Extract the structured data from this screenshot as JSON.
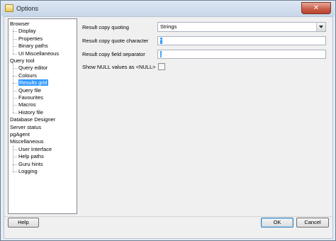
{
  "window": {
    "title": "Options",
    "close_glyph": "✕"
  },
  "tree": {
    "items": [
      {
        "label": "Browser",
        "level": 0
      },
      {
        "label": "Display",
        "level": 1
      },
      {
        "label": "Properties",
        "level": 1
      },
      {
        "label": "Binary paths",
        "level": 1
      },
      {
        "label": "UI Miscellaneous",
        "level": 1
      },
      {
        "label": "Query tool",
        "level": 0
      },
      {
        "label": "Query editor",
        "level": 1
      },
      {
        "label": "Colours",
        "level": 1
      },
      {
        "label": "Results grid",
        "level": 1,
        "selected": true
      },
      {
        "label": "Query file",
        "level": 1
      },
      {
        "label": "Favourites",
        "level": 1
      },
      {
        "label": "Macros",
        "level": 1
      },
      {
        "label": "History file",
        "level": 1
      },
      {
        "label": "Database Designer",
        "level": 0
      },
      {
        "label": "Server status",
        "level": 0
      },
      {
        "label": "pgAgent",
        "level": 0
      },
      {
        "label": "Miscellaneous",
        "level": 0
      },
      {
        "label": "User Interface",
        "level": 1
      },
      {
        "label": "Help paths",
        "level": 1
      },
      {
        "label": "Guru hints",
        "level": 1
      },
      {
        "label": "Logging",
        "level": 1
      }
    ]
  },
  "settings": {
    "copy_quoting_label": "Result copy quoting",
    "copy_quoting_value": "Strings",
    "quote_char_label": "Result copy quote character",
    "quote_char_value": "\"",
    "field_sep_label": "Result copy field separator",
    "field_sep_value": ";",
    "null_label": "Show NULL values as <NULL>",
    "null_checked": false
  },
  "buttons": {
    "help": "Help",
    "ok": "OK",
    "cancel": "Cancel"
  }
}
